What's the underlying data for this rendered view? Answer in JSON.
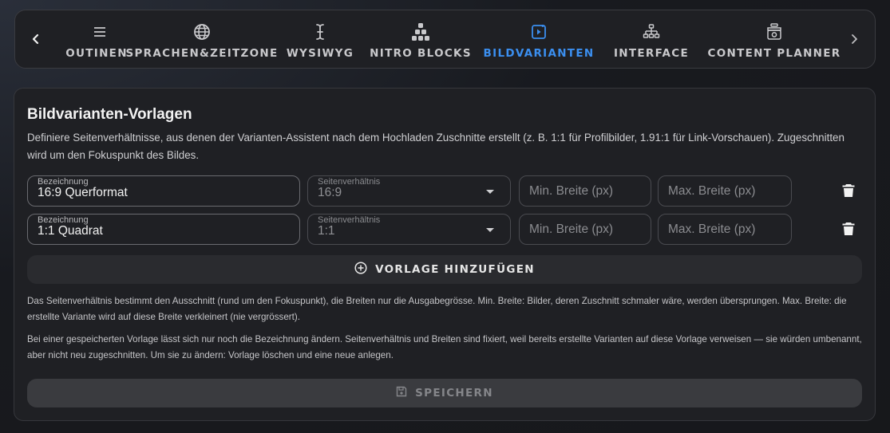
{
  "nav": {
    "prev_icon": "chevron-left-icon",
    "next_icon": "chevron-right-icon",
    "tabs": [
      {
        "label": "OUTINEN",
        "icon": "list-icon"
      },
      {
        "label": "SPRACHEN&ZEITZONE",
        "icon": "globe-icon"
      },
      {
        "label": "WYSIWYG",
        "icon": "text-cursor-icon"
      },
      {
        "label": "NITRO BLOCKS",
        "icon": "blocks-icon"
      },
      {
        "label": "BILDVARIANTEN",
        "icon": "image-variant-icon",
        "active": true
      },
      {
        "label": "INTERFACE",
        "icon": "sitemap-icon"
      },
      {
        "label": "CONTENT PLANNER",
        "icon": "planner-icon"
      }
    ]
  },
  "card": {
    "title": "Bildvarianten-Vorlagen",
    "description": "Definiere Seitenverhältnisse, aus denen der Varianten-Assistent nach dem Hochladen Zuschnitte erstellt (z. B. 1:1 für Profilbilder, 1.91:1 für Link-Vorschauen). Zugeschnitten wird um den Fokuspunkt des Bildes.",
    "templates": [
      {
        "name_label": "Bezeichnung",
        "name_value": "16:9 Querformat",
        "ratio_label": "Seitenverhältnis",
        "ratio_value": "16:9",
        "min_width_placeholder": "Min. Breite (px)",
        "max_width_placeholder": "Max. Breite (px)"
      },
      {
        "name_label": "Bezeichnung",
        "name_value": "1:1 Quadrat",
        "ratio_label": "Seitenverhältnis",
        "ratio_value": "1:1",
        "min_width_placeholder": "Min. Breite (px)",
        "max_width_placeholder": "Max. Breite (px)"
      }
    ],
    "add_button_label": "VORLAGE HINZUFÜGEN",
    "note_1": "Das Seitenverhältnis bestimmt den Ausschnitt (rund um den Fokuspunkt), die Breiten nur die Ausgabegrösse. Min. Breite: Bilder, deren Zuschnitt schmaler wäre, werden übersprungen. Max. Breite: die erstellte Variante wird auf diese Breite verkleinert (nie vergrössert).",
    "note_2": "Bei einer gespeicherten Vorlage lässt sich nur noch die Bezeichnung ändern. Seitenverhältnis und Breiten sind fixiert, weil bereits erstellte Varianten auf diese Vorlage verweisen — sie würden umbenannt, aber nicht neu zugeschnitten. Um sie zu ändern: Vorlage löschen und eine neue anlegen.",
    "save_button_label": "SPEICHERN"
  },
  "colors": {
    "accent": "#3b8ff0",
    "surface": "#1f2024",
    "border": "#3a3b40"
  }
}
